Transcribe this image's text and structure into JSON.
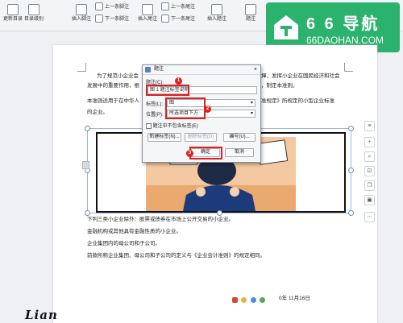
{
  "ribbon": {
    "items": [
      {
        "label": "更新目录",
        "icon": "refresh-icon"
      },
      {
        "label": "目录级别",
        "icon": "list-icon"
      },
      {
        "label": "插入脚注",
        "icon": "footnote-icon"
      },
      {
        "label": "插入尾注",
        "icon": "endnote-icon"
      },
      {
        "label": "插入题注",
        "icon": "caption-icon"
      },
      {
        "label": "题注",
        "icon": "caption-icon"
      }
    ],
    "small_items": [
      {
        "label": "上一条脚注",
        "icon": "prev-icon"
      },
      {
        "label": "下一条脚注",
        "icon": "next-icon"
      },
      {
        "label": "上一条尾注",
        "icon": "prev-icon"
      },
      {
        "label": "下一条尾注",
        "icon": "next-icon"
      }
    ]
  },
  "logo": {
    "name": "6 6 导航",
    "domain": "66DAOHAN.COM",
    "icon": "house-icon",
    "color": "#2bb26d"
  },
  "document": {
    "paragraphs": [
      "为了规范小企业会",
      "发展中的重要作用，根",
      "本准则适用于在中华人",
      "的企业。"
    ],
    "right_fragments": [
      "揮，发挥小企业在国民经济和社会",
      "，制定本准则。",
      "准规定》所规定的小型企业标准"
    ],
    "after_image": [
      "下列三类小企业除外：股票或债券在市场上公开交易的小企业。",
      "金融机构或其他具有金融性质的小企业。",
      "企业集团内的母公司和子公司。",
      "前款所称企业集团、母公司和子公司的定义与《企业会计准则》的规定相同。"
    ],
    "date_text": "0年 11月16日",
    "handwriting": "Lian"
  },
  "dialog": {
    "title": "题注",
    "close": "×",
    "caption_label": "题注(C):",
    "caption_value": "图 1 题注标签说明",
    "label_label": "标签(L):",
    "label_value": "图",
    "position_label": "位置(P):",
    "position_value": "所选项目下方",
    "exclude_label": "题注中不包含标签(E)",
    "new_label_button": "新建标签(N)...",
    "delete_label_button": "删除标签(D)",
    "numbering_button": "编号(U)...",
    "ok_button": "确定",
    "cancel_button": "取消"
  },
  "annotations": [
    "1",
    "2",
    "3"
  ],
  "colors": {
    "highlight": "#e02020",
    "accent": "#2bb26d"
  }
}
